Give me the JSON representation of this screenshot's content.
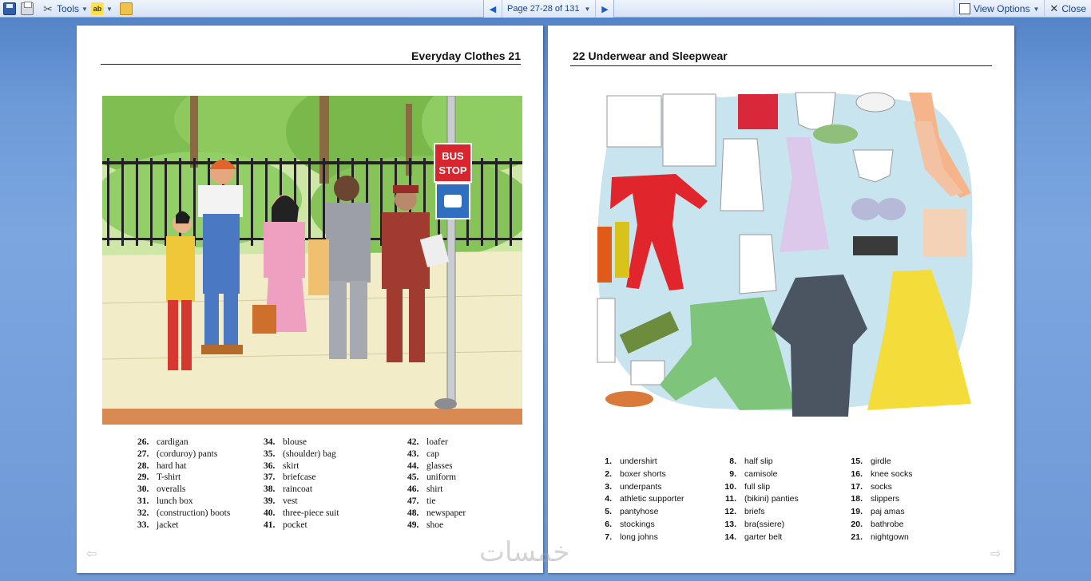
{
  "toolbar": {
    "tools_label": "Tools",
    "page_indicator": "Page 27-28 of 131",
    "view_options_label": "View Options",
    "close_label": "Close"
  },
  "left_page": {
    "heading": "Everyday Clothes  21",
    "illustration": {
      "sign_line1": "BUS",
      "sign_line2": "STOP"
    },
    "vocab_columns": [
      [
        {
          "num": "26.",
          "text": "cardigan"
        },
        {
          "num": "27.",
          "text": "(corduroy) pants"
        },
        {
          "num": "28.",
          "text": "hard hat"
        },
        {
          "num": "29.",
          "text": "T-shirt"
        },
        {
          "num": "30.",
          "text": "overalls"
        },
        {
          "num": "31.",
          "text": "lunch box"
        },
        {
          "num": "32.",
          "text": "(construction) boots"
        },
        {
          "num": "33.",
          "text": "jacket"
        }
      ],
      [
        {
          "num": "34.",
          "text": " blouse"
        },
        {
          "num": "35.",
          "text": "(shoulder) bag"
        },
        {
          "num": "36.",
          "text": " skirt"
        },
        {
          "num": "37.",
          "text": "briefcase"
        },
        {
          "num": "38.",
          "text": "raincoat"
        },
        {
          "num": "39.",
          "text": "vest"
        },
        {
          "num": "40.",
          "text": "three-piece suit"
        },
        {
          "num": "41.",
          "text": "pocket"
        }
      ],
      [
        {
          "num": "42.",
          "text": "loafer"
        },
        {
          "num": "43.",
          "text": "cap"
        },
        {
          "num": "44.",
          "text": "glasses"
        },
        {
          "num": "45.",
          "text": "uniform"
        },
        {
          "num": "46.",
          "text": "shirt"
        },
        {
          "num": "47.",
          "text": "tie"
        },
        {
          "num": "48.",
          "text": "newspaper"
        },
        {
          "num": "49.",
          "text": "shoe"
        }
      ]
    ]
  },
  "right_page": {
    "heading": "22  Underwear and Sleepwear",
    "vocab_columns": [
      [
        {
          "num": "1.",
          "text": "undershirt"
        },
        {
          "num": "2.",
          "text": "boxer shorts"
        },
        {
          "num": "3.",
          "text": "underpants"
        },
        {
          "num": "4.",
          "text": "athletic supporter"
        },
        {
          "num": "5.",
          "text": "pantyhose"
        },
        {
          "num": "6.",
          "text": "stockings"
        },
        {
          "num": "7.",
          "text": "long johns"
        }
      ],
      [
        {
          "num": "8.",
          "text": "half slip"
        },
        {
          "num": "9.",
          "text": "camisole"
        },
        {
          "num": "10.",
          "text": "full slip"
        },
        {
          "num": "11.",
          "text": "(bikini) panties"
        },
        {
          "num": "12.",
          "text": "briefs"
        },
        {
          "num": "13.",
          "text": "bra(ssiere)"
        },
        {
          "num": "14.",
          "text": "garter belt"
        }
      ],
      [
        {
          "num": "15.",
          "text": "girdle"
        },
        {
          "num": "16.",
          "text": "knee socks"
        },
        {
          "num": "17.",
          "text": "socks"
        },
        {
          "num": "18.",
          "text": "slippers"
        },
        {
          "num": "19.",
          "text": "paj amas"
        },
        {
          "num": "20.",
          "text": "bathrobe"
        },
        {
          "num": "21.",
          "text": " nightgown"
        }
      ]
    ]
  },
  "watermark": "خمسات"
}
